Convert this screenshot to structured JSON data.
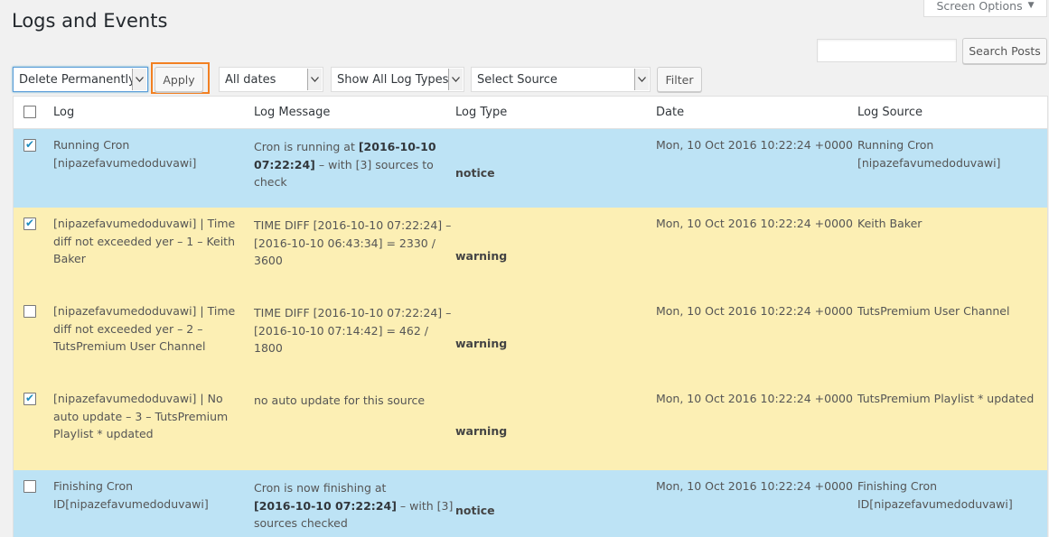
{
  "page": {
    "title": "Logs and Events",
    "screen_options_label": "Screen Options"
  },
  "search": {
    "value": "",
    "button_label": "Search Posts"
  },
  "toolbar": {
    "bulk_action": "Delete Permanently",
    "apply_label": "Apply",
    "dates_filter": "All dates",
    "log_types_filter": "Show All Log Types",
    "source_filter": "Select Source",
    "filter_label": "Filter"
  },
  "colors": {
    "notice_row": "#bde3f5",
    "warning_row": "#fcefb4",
    "highlight": "#f28022"
  },
  "table": {
    "headers": {
      "log": "Log",
      "message": "Log Message",
      "type": "Log Type",
      "date": "Date",
      "source": "Log Source"
    },
    "rows": [
      {
        "checked": true,
        "log": [
          "Running Cron",
          "[nipazefavumedoduvawi]"
        ],
        "message_lines": [
          [
            "Cron is running at ",
            "[2016-10-10"
          ],
          [
            "",
            "07:22:24]",
            " – with [3] sources to"
          ],
          [
            "check"
          ]
        ],
        "type": "notice",
        "date": "Mon, 10 Oct 2016 10:22:24 +0000",
        "source": [
          "Running Cron",
          "[nipazefavumedoduvawi]"
        ]
      },
      {
        "checked": true,
        "log": [
          "[nipazefavumedoduvawi] | Time",
          "diff not exceeded yer – 1 – Keith",
          "Baker"
        ],
        "message_lines": [
          [
            "TIME DIFF [2016-10-10 07:22:24] –"
          ],
          [
            "[2016-10-10 06:43:34] = 2330 /"
          ],
          [
            "3600"
          ]
        ],
        "type": "warning",
        "date": "Mon, 10 Oct 2016 10:22:24 +0000",
        "source": [
          "Keith Baker"
        ]
      },
      {
        "checked": false,
        "log": [
          "[nipazefavumedoduvawi] | Time",
          "diff not exceeded yer – 2 –",
          "TutsPremium User Channel"
        ],
        "message_lines": [
          [
            "TIME DIFF [2016-10-10 07:22:24] –"
          ],
          [
            "[2016-10-10 07:14:42] = 462 /"
          ],
          [
            "1800"
          ]
        ],
        "type": "warning",
        "date": "Mon, 10 Oct 2016 10:22:24 +0000",
        "source": [
          "TutsPremium User Channel"
        ]
      },
      {
        "checked": true,
        "log": [
          "[nipazefavumedoduvawi] | No",
          "auto update – 3 – TutsPremium",
          "Playlist * updated"
        ],
        "message_lines": [
          [
            "no auto update for this source"
          ]
        ],
        "type": "warning",
        "date": "Mon, 10 Oct 2016 10:22:24 +0000",
        "source": [
          "TutsPremium Playlist * updated"
        ]
      },
      {
        "checked": false,
        "log": [
          "Finishing Cron",
          "ID[nipazefavumedoduvawi]"
        ],
        "message_lines": [
          [
            "Cron is now finishing at"
          ],
          [
            "",
            "[2016-10-10 07:22:24]",
            " – with [3]"
          ],
          [
            "sources checked"
          ]
        ],
        "type": "notice",
        "date": "Mon, 10 Oct 2016 10:22:24 +0000",
        "source": [
          "Finishing Cron",
          "ID[nipazefavumedoduvawi]"
        ]
      }
    ]
  }
}
